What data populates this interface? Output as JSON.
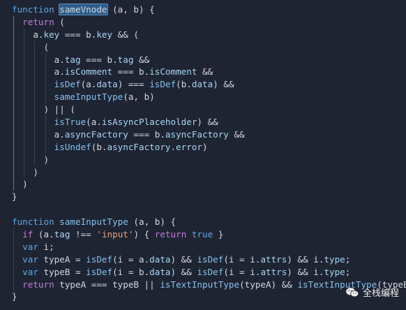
{
  "editor": {
    "theme_colors": {
      "background": "#1e2431",
      "keyword": "#c679dd",
      "function": "#86c1ee",
      "string": "#e5a079",
      "literal": "#5fa8e8",
      "selection": "#2e5c8a"
    },
    "lines": [
      [
        {
          "t": "kw2",
          "v": "function"
        },
        {
          "t": "pl",
          "v": " "
        },
        {
          "t": "hl",
          "v": "sameVnode"
        },
        {
          "t": "pl",
          "v": " (a, b) {"
        }
      ],
      [
        {
          "t": "pl",
          "v": "  "
        },
        {
          "t": "kw",
          "v": "return"
        },
        {
          "t": "pl",
          "v": " ("
        }
      ],
      [
        {
          "t": "pl",
          "v": "    a."
        },
        {
          "t": "prop",
          "v": "key"
        },
        {
          "t": "pl",
          "v": " === b."
        },
        {
          "t": "prop",
          "v": "key"
        },
        {
          "t": "pl",
          "v": " && ("
        }
      ],
      [
        {
          "t": "pl",
          "v": "      ("
        }
      ],
      [
        {
          "t": "pl",
          "v": "        a."
        },
        {
          "t": "prop",
          "v": "tag"
        },
        {
          "t": "pl",
          "v": " === b."
        },
        {
          "t": "prop",
          "v": "tag"
        },
        {
          "t": "pl",
          "v": " &&"
        }
      ],
      [
        {
          "t": "pl",
          "v": "        a."
        },
        {
          "t": "prop",
          "v": "isComment"
        },
        {
          "t": "pl",
          "v": " === b."
        },
        {
          "t": "prop",
          "v": "isComment"
        },
        {
          "t": "pl",
          "v": " &&"
        }
      ],
      [
        {
          "t": "pl",
          "v": "        "
        },
        {
          "t": "fn",
          "v": "isDef"
        },
        {
          "t": "pl",
          "v": "(a."
        },
        {
          "t": "prop",
          "v": "data"
        },
        {
          "t": "pl",
          "v": ") === "
        },
        {
          "t": "fn",
          "v": "isDef"
        },
        {
          "t": "pl",
          "v": "(b."
        },
        {
          "t": "prop",
          "v": "data"
        },
        {
          "t": "pl",
          "v": ") &&"
        }
      ],
      [
        {
          "t": "pl",
          "v": "        "
        },
        {
          "t": "fn",
          "v": "sameInputType"
        },
        {
          "t": "pl",
          "v": "(a, b)"
        }
      ],
      [
        {
          "t": "pl",
          "v": "      ) || ("
        }
      ],
      [
        {
          "t": "pl",
          "v": "        "
        },
        {
          "t": "fn",
          "v": "isTrue"
        },
        {
          "t": "pl",
          "v": "(a."
        },
        {
          "t": "prop",
          "v": "isAsyncPlaceholder"
        },
        {
          "t": "pl",
          "v": ") &&"
        }
      ],
      [
        {
          "t": "pl",
          "v": "        a."
        },
        {
          "t": "prop",
          "v": "asyncFactory"
        },
        {
          "t": "pl",
          "v": " === b."
        },
        {
          "t": "prop",
          "v": "asyncFactory"
        },
        {
          "t": "pl",
          "v": " &&"
        }
      ],
      [
        {
          "t": "pl",
          "v": "        "
        },
        {
          "t": "fn",
          "v": "isUndef"
        },
        {
          "t": "pl",
          "v": "(b."
        },
        {
          "t": "prop",
          "v": "asyncFactory"
        },
        {
          "t": "pl",
          "v": "."
        },
        {
          "t": "prop",
          "v": "error"
        },
        {
          "t": "pl",
          "v": ")"
        }
      ],
      [
        {
          "t": "pl",
          "v": "      )"
        }
      ],
      [
        {
          "t": "pl",
          "v": "    )"
        }
      ],
      [
        {
          "t": "pl",
          "v": "  )"
        }
      ],
      [
        {
          "t": "pl",
          "v": "}"
        }
      ],
      [],
      [
        {
          "t": "kw2",
          "v": "function"
        },
        {
          "t": "pl",
          "v": " "
        },
        {
          "t": "fn",
          "v": "sameInputType"
        },
        {
          "t": "pl",
          "v": " (a, b) {"
        }
      ],
      [
        {
          "t": "pl",
          "v": "  "
        },
        {
          "t": "kw",
          "v": "if"
        },
        {
          "t": "pl",
          "v": " (a."
        },
        {
          "t": "prop",
          "v": "tag"
        },
        {
          "t": "pl",
          "v": " !== "
        },
        {
          "t": "str",
          "v": "'input'"
        },
        {
          "t": "pl",
          "v": ") { "
        },
        {
          "t": "kw",
          "v": "return"
        },
        {
          "t": "pl",
          "v": " "
        },
        {
          "t": "lit",
          "v": "true"
        },
        {
          "t": "pl",
          "v": " }"
        }
      ],
      [
        {
          "t": "pl",
          "v": "  "
        },
        {
          "t": "kw2",
          "v": "var"
        },
        {
          "t": "pl",
          "v": " i;"
        }
      ],
      [
        {
          "t": "pl",
          "v": "  "
        },
        {
          "t": "kw2",
          "v": "var"
        },
        {
          "t": "pl",
          "v": " typeA = "
        },
        {
          "t": "fn",
          "v": "isDef"
        },
        {
          "t": "pl",
          "v": "(i = a."
        },
        {
          "t": "prop",
          "v": "data"
        },
        {
          "t": "pl",
          "v": ") && "
        },
        {
          "t": "fn",
          "v": "isDef"
        },
        {
          "t": "pl",
          "v": "(i = i."
        },
        {
          "t": "prop",
          "v": "attrs"
        },
        {
          "t": "pl",
          "v": ") && i."
        },
        {
          "t": "prop",
          "v": "type"
        },
        {
          "t": "pl",
          "v": ";"
        }
      ],
      [
        {
          "t": "pl",
          "v": "  "
        },
        {
          "t": "kw2",
          "v": "var"
        },
        {
          "t": "pl",
          "v": " typeB = "
        },
        {
          "t": "fn",
          "v": "isDef"
        },
        {
          "t": "pl",
          "v": "(i = b."
        },
        {
          "t": "prop",
          "v": "data"
        },
        {
          "t": "pl",
          "v": ") && "
        },
        {
          "t": "fn",
          "v": "isDef"
        },
        {
          "t": "pl",
          "v": "(i = i."
        },
        {
          "t": "prop",
          "v": "attrs"
        },
        {
          "t": "pl",
          "v": ") && i."
        },
        {
          "t": "prop",
          "v": "type"
        },
        {
          "t": "pl",
          "v": ";"
        }
      ],
      [
        {
          "t": "pl",
          "v": "  "
        },
        {
          "t": "kw",
          "v": "return"
        },
        {
          "t": "pl",
          "v": " typeA === typeB || "
        },
        {
          "t": "fn",
          "v": "isTextInputType"
        },
        {
          "t": "pl",
          "v": "(typeA) && "
        },
        {
          "t": "fn",
          "v": "isTextInputType"
        },
        {
          "t": "pl",
          "v": "(typeB)"
        }
      ],
      [
        {
          "t": "pl",
          "v": "}"
        }
      ]
    ]
  },
  "watermark": {
    "text": "全栈编程",
    "icon": "wechat-icon"
  }
}
